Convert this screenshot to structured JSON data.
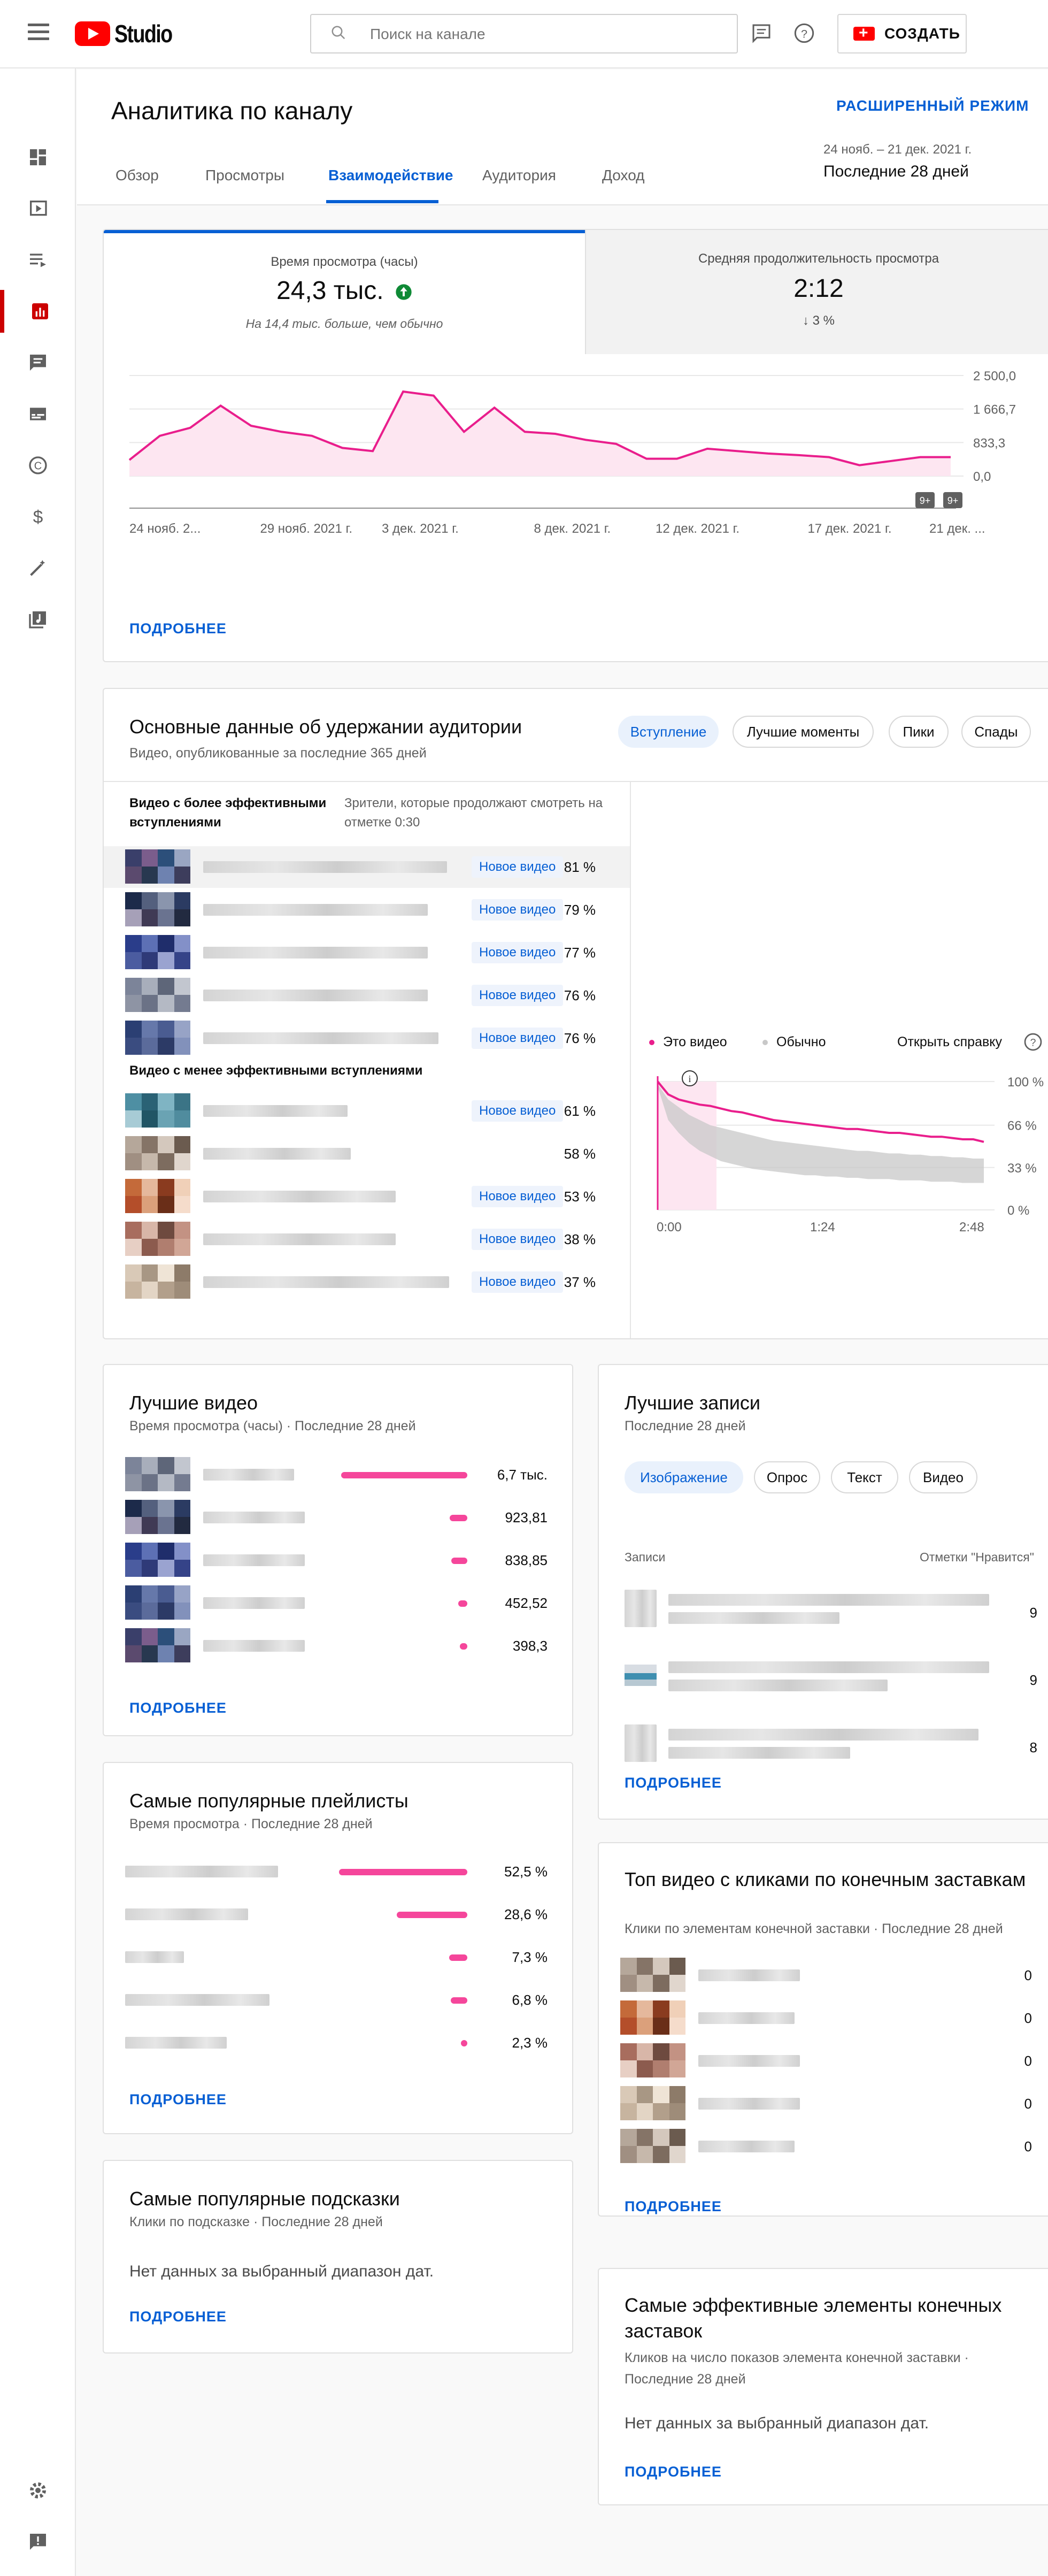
{
  "app": {
    "logo": "Studio",
    "search_placeholder": "Поиск на канале",
    "create_label": "СОЗДАТЬ"
  },
  "sidebar": {
    "icons": [
      "dashboard-icon",
      "content-icon",
      "playlists-icon",
      "analytics-icon",
      "comments-icon",
      "subtitles-icon",
      "copyright-icon",
      "monetization-icon",
      "customization-icon",
      "audio-library-icon"
    ],
    "bottom_icons": [
      "settings-icon",
      "feedback-icon"
    ]
  },
  "header": {
    "title": "Аналитика по каналу",
    "advanced_mode": "РАСШИРЕННЫЙ РЕЖИМ",
    "date_range": "24 нояб. – 21 дек. 2021 г.",
    "period": "Последние 28 дней",
    "tabs": [
      "Обзор",
      "Просмотры",
      "Взаимодействие",
      "Аудитория",
      "Доход"
    ]
  },
  "overview": {
    "metric1": {
      "label": "Время просмотра (часы)",
      "value": "24,3 тыс.",
      "note": "На 14,4 тыс. больше, чем обычно"
    },
    "metric2": {
      "label": "Средняя продолжительность просмотра",
      "value": "2:12",
      "change": "↓ 3 %"
    },
    "more": "ПОДРОБНЕЕ",
    "chart_data": {
      "type": "line",
      "x": [
        "24 нояб. 2...",
        "25",
        "26",
        "27",
        "28",
        "29 нояб. 2021 г.",
        "30",
        "1",
        "2",
        "3 дек. 2021 г.",
        "4",
        "5",
        "6",
        "7",
        "8 дек. 2021 г.",
        "9",
        "10",
        "11",
        "12 дек. 2021 г.",
        "13",
        "14",
        "15",
        "16",
        "17 дек. 2021 г.",
        "18",
        "19",
        "20",
        "21 дек."
      ],
      "x_tick_labels": [
        "24 нояб. 2...",
        "29 нояб. 2021 г.",
        "3 дек. 2021 г.",
        "8 дек. 2021 г.",
        "12 дек. 2021 г.",
        "17 дек. 2021 г.",
        "21 дек. ..."
      ],
      "series": [
        {
          "values": [
            400,
            1000,
            1200,
            1750,
            1250,
            1100,
            1000,
            700,
            620,
            2100,
            2000,
            1100,
            1700,
            1100,
            1050,
            900,
            800,
            430,
            430,
            680,
            620,
            560,
            520,
            470,
            270,
            370,
            470,
            470
          ]
        }
      ],
      "y_tick_labels": [
        "2 500,0",
        "1 666,7",
        "833,3",
        "0,0"
      ],
      "ylim": [
        0,
        2500
      ],
      "markers": [
        "9+",
        "9+"
      ],
      "accent": "#e91e8c"
    }
  },
  "retention": {
    "title": "Основные данные об удержании аудитории",
    "subtitle": "Видео, опубликованные за последние 365 дней",
    "chips": [
      "Вступление",
      "Лучшие моменты",
      "Пики",
      "Спады"
    ],
    "col_head_left": "Видео с более эффективными вступлениями",
    "col_head_right": "Зрители, которые продолжают смотреть на отметке 0:30",
    "better": [
      {
        "badge": "Новое видео",
        "pct": "81 %"
      },
      {
        "badge": "Новое видео",
        "pct": "79 %"
      },
      {
        "badge": "Новое видео",
        "pct": "77 %"
      },
      {
        "badge": "Новое видео",
        "pct": "76 %"
      },
      {
        "badge": "Новое видео",
        "pct": "76 %"
      }
    ],
    "worse_head": "Видео с менее эффективными вступлениями",
    "worse": [
      {
        "badge": "Новое видео",
        "pct": "61 %"
      },
      {
        "badge": "",
        "pct": "58 %"
      },
      {
        "badge": "Новое видео",
        "pct": "53 %"
      },
      {
        "badge": "Новое видео",
        "pct": "38 %"
      },
      {
        "badge": "Новое видео",
        "pct": "37 %"
      }
    ],
    "legend_this": "Это видео",
    "legend_typical": "Обычно",
    "help_link": "Открыть справку",
    "chart_data": {
      "type": "area",
      "x_tick_labels": [
        "0:00",
        "1:24",
        "2:48"
      ],
      "y_tick_labels": [
        "100 %",
        "66 %",
        "33 %",
        "0 %"
      ],
      "ylim": [
        0,
        100
      ],
      "series": [
        {
          "name": "Это видео",
          "values": [
            100,
            90,
            86,
            84,
            82,
            81,
            79,
            77,
            76,
            74,
            72,
            70,
            69,
            68,
            67,
            66,
            65,
            64,
            63,
            63,
            62,
            61,
            60,
            60,
            59,
            58,
            57,
            57,
            56,
            55,
            55,
            53
          ]
        },
        {
          "name": "Обычно",
          "values_top": [
            98,
            86,
            80,
            74,
            70,
            66,
            64,
            62,
            60,
            58,
            56,
            54,
            53,
            52,
            51,
            50,
            49,
            48,
            47,
            46,
            46,
            45,
            44,
            44,
            43,
            43,
            42,
            42,
            41,
            41,
            40,
            40
          ],
          "values_bottom": [
            96,
            70,
            60,
            52,
            46,
            42,
            38,
            36,
            34,
            32,
            31,
            30,
            29,
            28,
            27,
            27,
            26,
            26,
            25,
            25,
            24,
            24,
            24,
            23,
            23,
            23,
            22,
            22,
            22,
            21,
            21,
            21
          ]
        }
      ],
      "colors": {
        "this": "#e91e8c",
        "typical": "#c8c8c8"
      }
    }
  },
  "top_videos": {
    "title": "Лучшие видео",
    "subtitle": "Время просмотра (часы) · Последние 28 дней",
    "rows": [
      {
        "value": "6,7 тыс.",
        "frac": 1.0
      },
      {
        "value": "923,81",
        "frac": 0.14
      },
      {
        "value": "838,85",
        "frac": 0.125
      },
      {
        "value": "452,52",
        "frac": 0.07
      },
      {
        "value": "398,3",
        "frac": 0.06
      }
    ],
    "more": "ПОДРОБНЕЕ"
  },
  "top_posts": {
    "title": "Лучшие записи",
    "subtitle": "Последние 28 дней",
    "chips": [
      "Изображение",
      "Опрос",
      "Текст",
      "Видео"
    ],
    "col_left": "Записи",
    "col_right": "Отметки \"Нравится\"",
    "rows": [
      {
        "value": "9"
      },
      {
        "value": "9"
      },
      {
        "value": "8"
      }
    ],
    "more": "ПОДРОБНЕЕ"
  },
  "playlists": {
    "title": "Самые популярные плейлисты",
    "subtitle": "Время просмотра · Последние 28 дней",
    "rows": [
      {
        "value": "52,5 %",
        "frac": 1.0
      },
      {
        "value": "28,6 %",
        "frac": 0.55
      },
      {
        "value": "7,3 %",
        "frac": 0.14
      },
      {
        "value": "6,8 %",
        "frac": 0.13
      },
      {
        "value": "2,3 %",
        "frac": 0.05
      }
    ],
    "more": "ПОДРОБНЕЕ"
  },
  "endscreen": {
    "title": "Топ видео с кликами по конечным заставкам",
    "subtitle": "Клики по элементам конечной заставки · Последние 28 дней",
    "rows": [
      {
        "value": "0"
      },
      {
        "value": "0"
      },
      {
        "value": "0"
      },
      {
        "value": "0"
      },
      {
        "value": "0"
      }
    ],
    "more": "ПОДРОБНЕЕ"
  },
  "cards": {
    "title": "Самые популярные подсказки",
    "subtitle": "Клики по подсказке · Последние 28 дней",
    "nodata": "Нет данных за выбранный диапазон дат.",
    "more": "ПОДРОБНЕЕ"
  },
  "endscreen_elements": {
    "title": "Самые эффективные элементы конечных заставок",
    "subtitle": "Кликов на число показов элемента конечной заставки · Последние 28 дней",
    "nodata": "Нет данных за выбранный диапазон дат.",
    "more": "ПОДРОБНЕЕ"
  }
}
